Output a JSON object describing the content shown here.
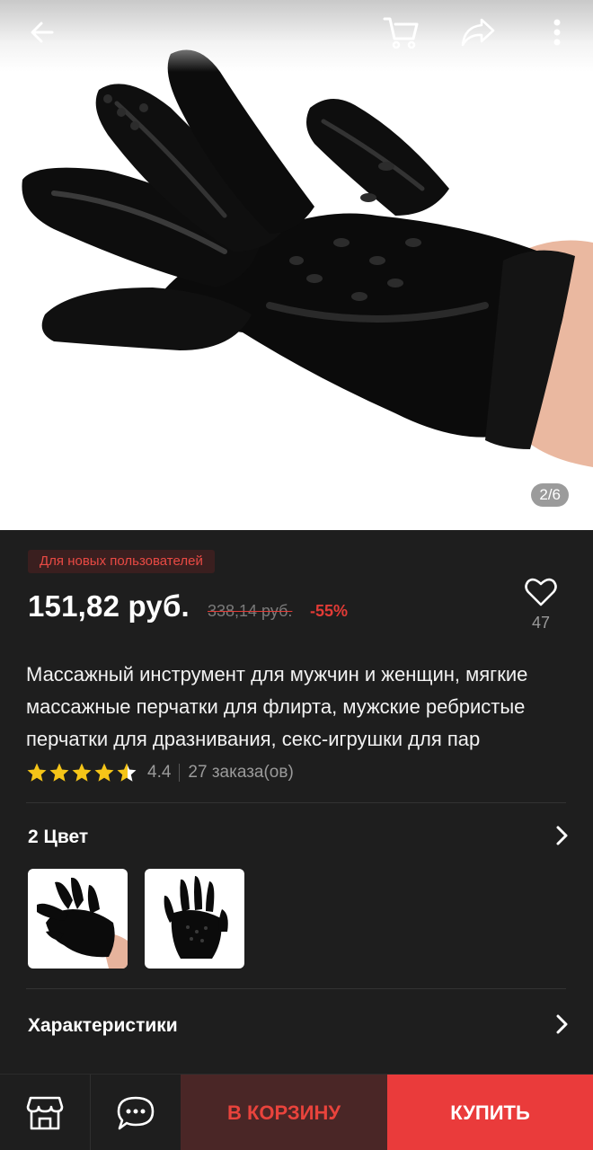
{
  "gallery": {
    "counter": "2/6",
    "icons": [
      "back-arrow-icon",
      "cart-icon",
      "share-icon",
      "more-icon"
    ]
  },
  "product": {
    "promo_label": "Для новых пользователей",
    "price": "151,82 руб.",
    "old_price": "338,14 руб.",
    "discount": "-55%",
    "wishlist_count": "47",
    "title": "Массажный инструмент для мужчин и женщин, мягкие массажные перчатки для флирта, мужские ребристые перчатки для дразнивания, секс-игрушки для пар",
    "rating": "4.4",
    "rating_value": 4.4,
    "orders": "27 заказа(ов)"
  },
  "options": {
    "color_title": "2 Цвет",
    "thumbnail_count": 2
  },
  "specs": {
    "title": "Характеристики"
  },
  "bottom_bar": {
    "cart_label": "В КОРЗИНУ",
    "buy_label": "КУПИТЬ",
    "icons": [
      "store-icon",
      "chat-icon"
    ]
  },
  "colors": {
    "accent": "#ea3b3b",
    "cart_button_bg": "#4a2626",
    "star": "#f5c518",
    "background": "#1e1e1e"
  }
}
